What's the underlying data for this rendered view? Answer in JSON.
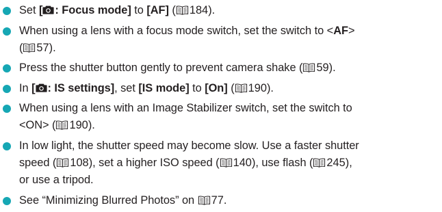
{
  "icons": {
    "bullet": "teal-dot-bullet",
    "camera": "camera-shooting-menu-icon",
    "page_ref": "open-book-page-reference-icon"
  },
  "colors": {
    "bullet": "#16a7b4",
    "text": "#231f20"
  },
  "items": [
    {
      "t1": "Set ",
      "b1": "[",
      "b2": ": Focus mode]",
      "t2": " to ",
      "b3": "[AF]",
      "t3": " (",
      "page": "184",
      "t4": ")."
    },
    {
      "t1": "When using a lens with a focus mode switch, set the switch to <",
      "b1": "AF",
      "t2": ">",
      "t3": "(",
      "page": "57",
      "t4": ")."
    },
    {
      "t1": "Press the shutter button gently to prevent camera shake (",
      "page": "59",
      "t2": ")."
    },
    {
      "t1": "In ",
      "b1": "[",
      "b2": ": IS settings]",
      "t2": ", set ",
      "b3": "[IS mode]",
      "t3": " to ",
      "b4": "[On]",
      "t4": " (",
      "page": "190",
      "t5": ")."
    },
    {
      "t1": "When using a lens with an Image Stabilizer switch, set the switch to",
      "t2": "<ON> (",
      "page": "190",
      "t3": ")."
    },
    {
      "t1": "In low light, the shutter speed may become slow. Use a faster shutter",
      "t2": "speed (",
      "page1": "108",
      "t3": "), set a higher ISO speed (",
      "page2": "140",
      "t4": "), use flash (",
      "page3": "245",
      "t5": "),",
      "t6": "or use a tripod."
    },
    {
      "t1": "See “Minimizing Blurred Photos” on ",
      "page": "77",
      "t2": "."
    }
  ]
}
